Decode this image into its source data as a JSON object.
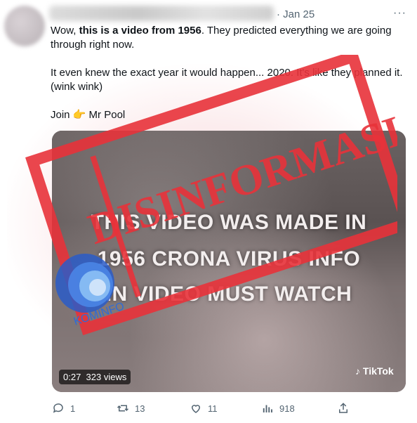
{
  "tweet": {
    "date": "· Jan 25",
    "more": "···",
    "line1_pre": "Wow, ",
    "line1_bold": "this is a video from 1956",
    "line1_post": ". They predicted everything we are going through right now.",
    "line2": "It even knew the exact year it would happen... 2020.  It's like they planned it. (wink wink)",
    "line3_pre": "Join",
    "line3_emoji": "👉",
    "line3_post": " Mr Pool"
  },
  "video": {
    "caption": [
      "THIS VIDEO WAS MADE IN",
      "1956 CRONA VIRUS INFO",
      "IN VIDEO MUST WATCH"
    ],
    "duration": "0:27",
    "views": "323 views",
    "watermark": "TikTok"
  },
  "stamp": {
    "text": "DISINFORMASI",
    "logo_text": "KOMINFO",
    "color": "#e8323a"
  },
  "actions": {
    "replies": "1",
    "retweets": "13",
    "likes": "11",
    "views": "918"
  }
}
